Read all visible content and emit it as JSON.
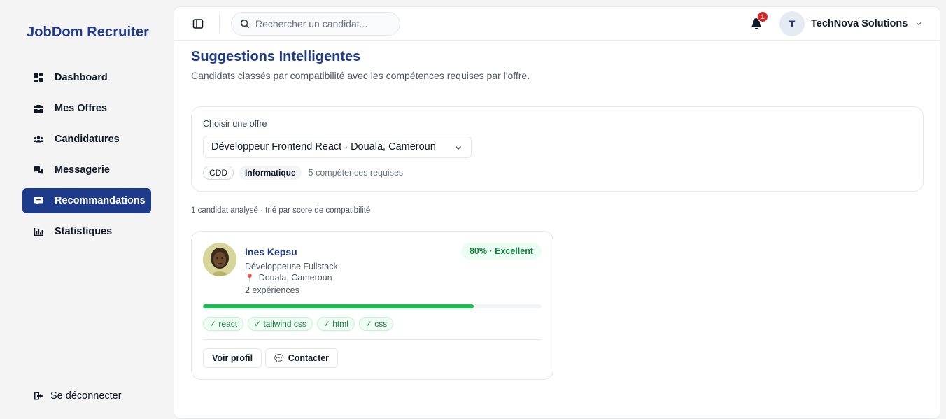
{
  "brand": "JobDom Recruiter",
  "sidebar": {
    "items": [
      {
        "label": "Dashboard",
        "icon": "dashboard-icon",
        "active": false
      },
      {
        "label": "Mes Offres",
        "icon": "briefcase-icon",
        "active": false
      },
      {
        "label": "Candidatures",
        "icon": "users-icon",
        "active": false
      },
      {
        "label": "Messagerie",
        "icon": "chat-icon",
        "active": false
      },
      {
        "label": "Recommandations",
        "icon": "message-square-icon",
        "active": true
      },
      {
        "label": "Statistiques",
        "icon": "bar-chart-icon",
        "active": false
      }
    ],
    "logout_label": "Se déconnecter"
  },
  "topbar": {
    "search_placeholder": "Rechercher un candidat...",
    "notification_count": "1",
    "account_initial": "T",
    "account_name": "TechNova Solutions"
  },
  "page": {
    "title": "Suggestions Intelligentes",
    "subtitle": "Candidats classés par compatibilité avec les compétences requises par l'offre."
  },
  "offer": {
    "label": "Choisir une offre",
    "selected": "Développeur Frontend React · Douala, Cameroun",
    "contract": "CDD",
    "domain": "Informatique",
    "skills_note": "5 compétences requises"
  },
  "analysis_text": "1 candidat analysé · trié par score de compatibilité",
  "candidate": {
    "name": "Ines Kepsu",
    "role": "Développeuse Fullstack",
    "location": "Douala, Cameroun",
    "experience": "2 expériences",
    "score_label": "80% · Excellent",
    "score": 80,
    "skills": [
      "✓ react",
      "✓ tailwind css",
      "✓ html",
      "✓ css"
    ],
    "view_label": "Voir profil",
    "contact_label": "Contacter"
  },
  "colors": {
    "accent": "#1e3a8a",
    "success": "#16c252",
    "badge": "#dc2626"
  }
}
